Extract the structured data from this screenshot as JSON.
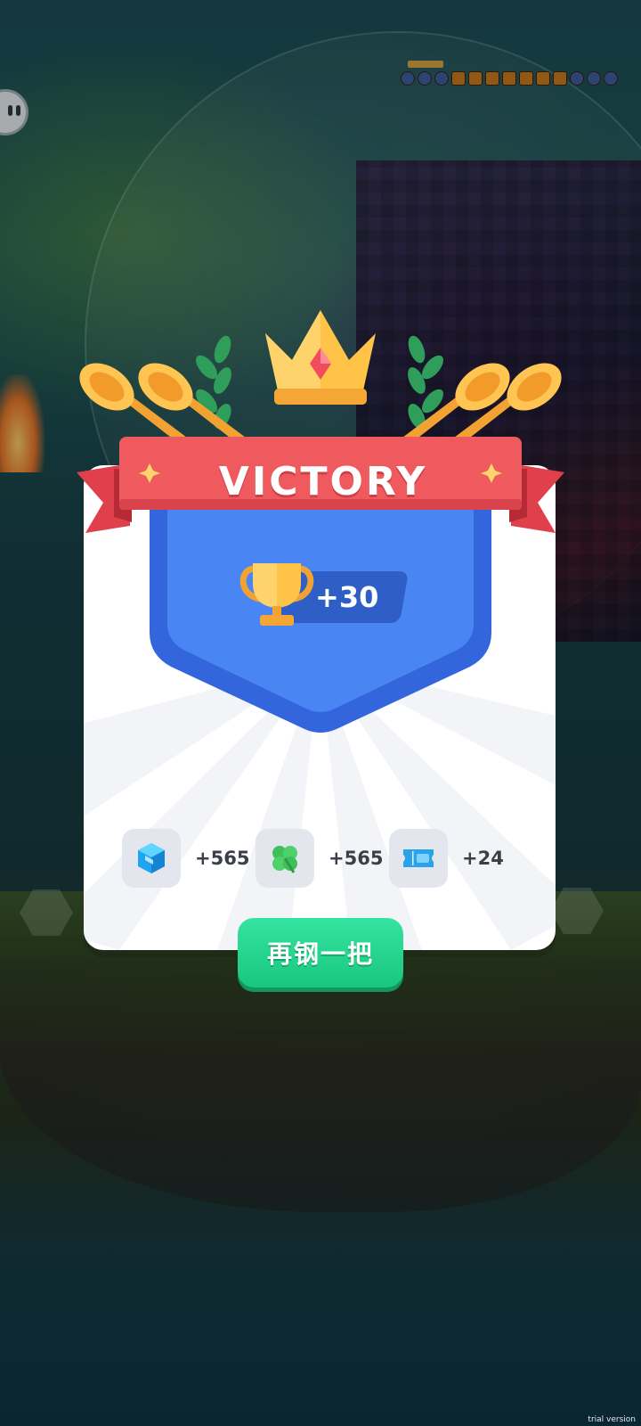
{
  "dialog": {
    "title": "VICTORY",
    "trophy": {
      "icon": "trophy-icon",
      "value": "+30"
    },
    "rewards": [
      {
        "icon": "gem-cube-icon",
        "value": "+565"
      },
      {
        "icon": "four-leaf-clover-icon",
        "value": "+565"
      },
      {
        "icon": "ticket-icon",
        "value": "+24"
      }
    ],
    "play_again_label": "再钢一把"
  },
  "watermark": "trial version",
  "colors": {
    "ribbon": "#ef5a5f",
    "shield": "#3f7ff0",
    "button": "#1fd28a",
    "trophy_gold": "#f7b84a"
  }
}
